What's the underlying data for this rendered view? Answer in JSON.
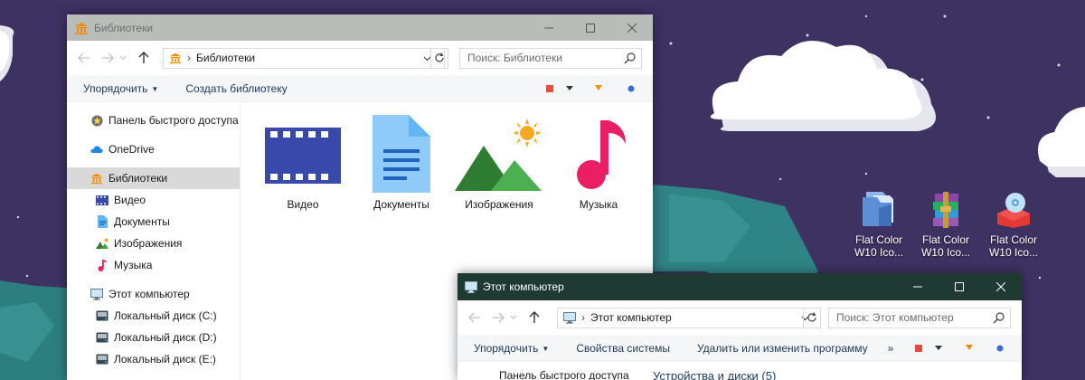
{
  "colors": {
    "desktop": "#3e3263",
    "window1_title": "#b9bdb9",
    "window2_title": "#1e3a33",
    "accent_orange": "#f28d00"
  },
  "desktop": {
    "icons": [
      {
        "label_line1": "Flat Color",
        "label_line2": "W10 Ico...",
        "icon": "folder-flat-icon"
      },
      {
        "label_line1": "Flat Color",
        "label_line2": "W10 Ico...",
        "icon": "archive-books-icon"
      },
      {
        "label_line1": "Flat Color",
        "label_line2": "W10 Ico...",
        "icon": "disc-drive-icon"
      }
    ]
  },
  "window1": {
    "title": "Библиотеки",
    "address": {
      "path": "Библиотеки"
    },
    "search": {
      "placeholder": "Поиск: Библиотеки"
    },
    "commands": {
      "organize": "Упорядочить",
      "create_library": "Создать библиотеку"
    },
    "nav": {
      "quick_access": "Панель быстрого доступа",
      "onedrive": "OneDrive",
      "libraries": "Библиотеки",
      "video": "Видео",
      "documents": "Документы",
      "images": "Изображения",
      "music": "Музыка",
      "this_pc": "Этот компьютер",
      "disk_c": "Локальный диск (C:)",
      "disk_d": "Локальный диск (D:)",
      "disk_e": "Локальный диск (E:)"
    },
    "tiles": {
      "video": "Видео",
      "documents": "Документы",
      "images": "Изображения",
      "music": "Музыка"
    }
  },
  "window2": {
    "title": "Этот компьютер",
    "address": {
      "path": "Этот компьютер"
    },
    "search": {
      "placeholder": "Поиск: Этот компьютер"
    },
    "commands": {
      "organize": "Упорядочить",
      "system_props": "Свойства системы",
      "uninstall": "Удалить или изменить программу",
      "more": "»"
    },
    "peek": {
      "quick_access": "Панель быстрого доступа",
      "devices": "Устройства и диски (5)"
    }
  }
}
